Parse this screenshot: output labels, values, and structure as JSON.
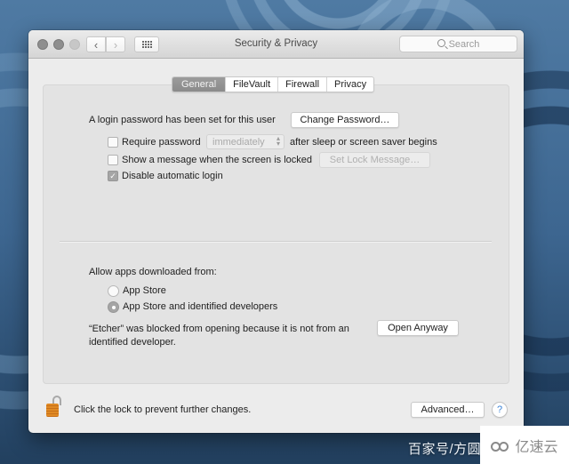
{
  "window": {
    "title": "Security & Privacy",
    "search_placeholder": "Search",
    "nav": {
      "back": "‹",
      "forward": "›"
    }
  },
  "tabs": [
    {
      "label": "General",
      "active": true
    },
    {
      "label": "FileVault",
      "active": false
    },
    {
      "label": "Firewall",
      "active": false
    },
    {
      "label": "Privacy",
      "active": false
    }
  ],
  "general": {
    "login_password_text": "A login password has been set for this user",
    "change_password_button": "Change Password…",
    "require_password": {
      "label": "Require password",
      "checked": false,
      "select_value": "immediately",
      "suffix": "after sleep or screen saver begins"
    },
    "show_message": {
      "label": "Show a message when the screen is locked",
      "checked": false,
      "button": "Set Lock Message…"
    },
    "disable_auto_login": {
      "label": "Disable automatic login",
      "checked": true,
      "check_glyph": "✓"
    },
    "allow_apps_label": "Allow apps downloaded from:",
    "allow_options": [
      {
        "label": "App Store",
        "selected": false
      },
      {
        "label": "App Store and identified developers",
        "selected": true
      }
    ],
    "blocked_message_line1": "“Etcher” was blocked from opening because it is not from an",
    "blocked_message_line2": "identified developer.",
    "open_anyway_button": "Open Anyway"
  },
  "footer": {
    "lock_text": "Click the lock to prevent further changes.",
    "advanced_button": "Advanced…",
    "help_label": "?"
  },
  "watermark": {
    "left": "百家号/方圆",
    "right": "亿速云"
  },
  "colors": {
    "window_bg": "#ececec",
    "panel_bg": "#e3e3e3",
    "active_tab": "#8f8f8f",
    "lock_orange": "#e08a24",
    "help_blue": "#3a82d6"
  }
}
